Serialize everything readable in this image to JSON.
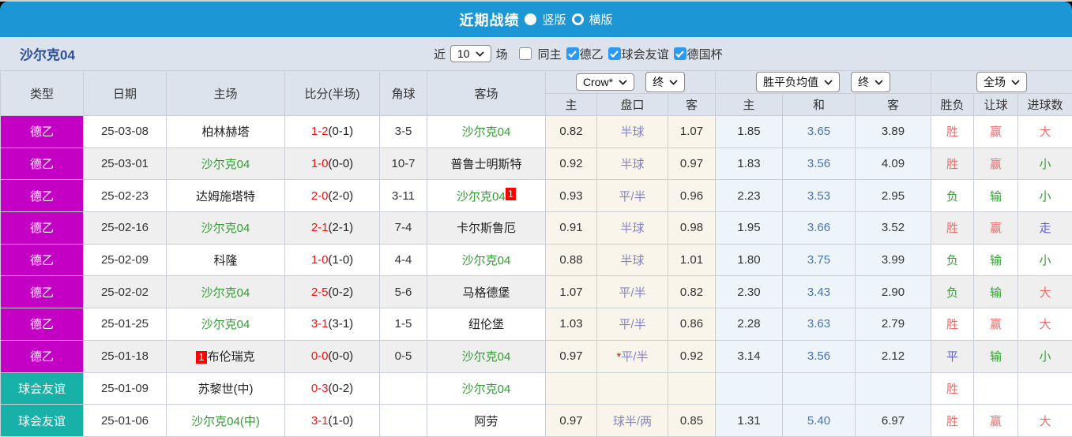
{
  "title_bar": {
    "title": "近期战绩",
    "vertical_label": "竖版",
    "horizontal_label": "横版",
    "selected_layout": "竖版"
  },
  "team_bar": {
    "team": "沙尔克04",
    "near_label": "近",
    "match_count": "10",
    "matches_label": "场",
    "checkboxes": [
      {
        "label": "同主",
        "checked": false
      },
      {
        "label": "德乙",
        "checked": true
      },
      {
        "label": "球会友谊",
        "checked": true
      },
      {
        "label": "德国杯",
        "checked": true
      }
    ]
  },
  "table": {
    "static_headers": [
      "类型",
      "日期",
      "主场",
      "比分(半场)",
      "角球",
      "客场"
    ],
    "selects": {
      "company": "Crow*",
      "company_time": "终",
      "odds": "胜平负均值",
      "odds_time": "终",
      "scope": "全场"
    },
    "sub_headers": [
      "主",
      "盘口",
      "客",
      "主",
      "和",
      "客",
      "胜负",
      "让球",
      "进球数"
    ],
    "rows": [
      {
        "type": "德乙",
        "type_class": "league",
        "date": "25-03-08",
        "home": "柏林赫塔",
        "home_green": false,
        "home_badge": "",
        "score": "1-2",
        "half": "(0-1)",
        "corners": "3-5",
        "away": "沙尔克04",
        "away_green": true,
        "away_badge": "",
        "ah_home": "0.82",
        "ah_line": "半球",
        "ah_star": false,
        "ah_away": "1.07",
        "od_home": "1.85",
        "od_draw": "3.65",
        "od_away": "3.89",
        "result": "胜",
        "result_color": "red",
        "handicap_result": "赢",
        "handicap_result_color": "red",
        "goals": "大",
        "goals_color": "red",
        "shaded": false
      },
      {
        "type": "德乙",
        "type_class": "league",
        "date": "25-03-01",
        "home": "沙尔克04",
        "home_green": true,
        "home_badge": "",
        "score": "1-0",
        "half": "(0-0)",
        "corners": "10-7",
        "away": "普鲁士明斯特",
        "away_green": false,
        "away_badge": "",
        "ah_home": "0.92",
        "ah_line": "半球",
        "ah_star": false,
        "ah_away": "0.97",
        "od_home": "1.83",
        "od_draw": "3.56",
        "od_away": "4.09",
        "result": "胜",
        "result_color": "red",
        "handicap_result": "赢",
        "handicap_result_color": "red",
        "goals": "小",
        "goals_color": "green",
        "shaded": true
      },
      {
        "type": "德乙",
        "type_class": "league",
        "date": "25-02-23",
        "home": "达姆施塔特",
        "home_green": false,
        "home_badge": "",
        "score": "2-0",
        "half": "(2-0)",
        "corners": "3-11",
        "away": "沙尔克04",
        "away_green": true,
        "away_badge": "1",
        "ah_home": "0.93",
        "ah_line": "平/半",
        "ah_star": false,
        "ah_away": "0.96",
        "od_home": "2.23",
        "od_draw": "3.53",
        "od_away": "2.95",
        "result": "负",
        "result_color": "green",
        "handicap_result": "输",
        "handicap_result_color": "green",
        "goals": "小",
        "goals_color": "green",
        "shaded": false
      },
      {
        "type": "德乙",
        "type_class": "league",
        "date": "25-02-16",
        "home": "沙尔克04",
        "home_green": true,
        "home_badge": "",
        "score": "2-1",
        "half": "(2-1)",
        "corners": "7-4",
        "away": "卡尔斯鲁厄",
        "away_green": false,
        "away_badge": "",
        "ah_home": "0.91",
        "ah_line": "半球",
        "ah_star": false,
        "ah_away": "0.98",
        "od_home": "1.95",
        "od_draw": "3.66",
        "od_away": "3.52",
        "result": "胜",
        "result_color": "red",
        "handicap_result": "赢",
        "handicap_result_color": "red",
        "goals": "走",
        "goals_color": "blue",
        "shaded": true
      },
      {
        "type": "德乙",
        "type_class": "league",
        "date": "25-02-09",
        "home": "科隆",
        "home_green": false,
        "home_badge": "",
        "score": "1-0",
        "half": "(1-0)",
        "corners": "4-4",
        "away": "沙尔克04",
        "away_green": true,
        "away_badge": "",
        "ah_home": "0.88",
        "ah_line": "半球",
        "ah_star": false,
        "ah_away": "1.01",
        "od_home": "1.80",
        "od_draw": "3.75",
        "od_away": "3.99",
        "result": "负",
        "result_color": "green",
        "handicap_result": "输",
        "handicap_result_color": "green",
        "goals": "小",
        "goals_color": "green",
        "shaded": false
      },
      {
        "type": "德乙",
        "type_class": "league",
        "date": "25-02-02",
        "home": "沙尔克04",
        "home_green": true,
        "home_badge": "",
        "score": "2-5",
        "half": "(0-2)",
        "corners": "5-6",
        "away": "马格德堡",
        "away_green": false,
        "away_badge": "",
        "ah_home": "1.07",
        "ah_line": "平/半",
        "ah_star": false,
        "ah_away": "0.82",
        "od_home": "2.30",
        "od_draw": "3.43",
        "od_away": "2.90",
        "result": "负",
        "result_color": "green",
        "handicap_result": "输",
        "handicap_result_color": "green",
        "goals": "大",
        "goals_color": "red",
        "shaded": true
      },
      {
        "type": "德乙",
        "type_class": "league",
        "date": "25-01-25",
        "home": "沙尔克04",
        "home_green": true,
        "home_badge": "",
        "score": "3-1",
        "half": "(3-1)",
        "corners": "1-5",
        "away": "纽伦堡",
        "away_green": false,
        "away_badge": "",
        "ah_home": "1.03",
        "ah_line": "平/半",
        "ah_star": false,
        "ah_away": "0.86",
        "od_home": "2.28",
        "od_draw": "3.63",
        "od_away": "2.79",
        "result": "胜",
        "result_color": "red",
        "handicap_result": "赢",
        "handicap_result_color": "red",
        "goals": "大",
        "goals_color": "red",
        "shaded": false
      },
      {
        "type": "德乙",
        "type_class": "league",
        "date": "25-01-18",
        "home": "布伦瑞克",
        "home_green": false,
        "home_badge": "1",
        "score": "0-0",
        "half": "(0-0)",
        "corners": "0-5",
        "away": "沙尔克04",
        "away_green": true,
        "away_badge": "",
        "ah_home": "0.97",
        "ah_line": "平/半",
        "ah_star": true,
        "ah_away": "0.92",
        "od_home": "3.14",
        "od_draw": "3.56",
        "od_away": "2.12",
        "result": "平",
        "result_color": "blue",
        "handicap_result": "输",
        "handicap_result_color": "green",
        "goals": "小",
        "goals_color": "green",
        "shaded": true
      },
      {
        "type": "球会友谊",
        "type_class": "friendly",
        "date": "25-01-09",
        "home": "苏黎世(中)",
        "home_green": false,
        "home_badge": "",
        "score": "0-3",
        "half": "(0-2)",
        "corners": "",
        "away": "沙尔克04",
        "away_green": true,
        "away_badge": "",
        "ah_home": "",
        "ah_line": "",
        "ah_star": false,
        "ah_away": "",
        "od_home": "",
        "od_draw": "",
        "od_away": "",
        "result": "胜",
        "result_color": "red",
        "handicap_result": "",
        "handicap_result_color": "red",
        "goals": "",
        "goals_color": "red",
        "shaded": false
      },
      {
        "type": "球会友谊",
        "type_class": "friendly",
        "date": "25-01-06",
        "home": "沙尔克04(中)",
        "home_green": true,
        "home_badge": "",
        "score": "3-1",
        "half": "(1-0)",
        "corners": "",
        "away": "阿劳",
        "away_green": false,
        "away_badge": "",
        "ah_home": "0.97",
        "ah_line": "球半/两",
        "ah_star": false,
        "ah_away": "0.85",
        "od_home": "1.31",
        "od_draw": "5.40",
        "od_away": "6.97",
        "result": "胜",
        "result_color": "red",
        "handicap_result": "赢",
        "handicap_result_color": "red",
        "goals": "大",
        "goals_color": "red",
        "shaded": false
      }
    ]
  },
  "colors": {
    "title_bar_blue": "#1c96d4",
    "league_badge_magenta": "#c400c4",
    "friendly_badge_teal": "#17b1a8",
    "team_green": "#2f9e2f",
    "score_red": "#f21212",
    "win_red": "#ed6d6d",
    "lose_green": "#35a035",
    "draw_blue": "#5f5fe0",
    "draw_odds_blue": "#4a72b0",
    "handicap_line_purple": "#8585c5",
    "checkbox_blue": "#2b9af3",
    "header_bg": "#dde3ec",
    "stripe_gray": "#efefef",
    "handicap_col_bg": "#faf5ea",
    "odds_col_bg": "#eef5fa"
  }
}
